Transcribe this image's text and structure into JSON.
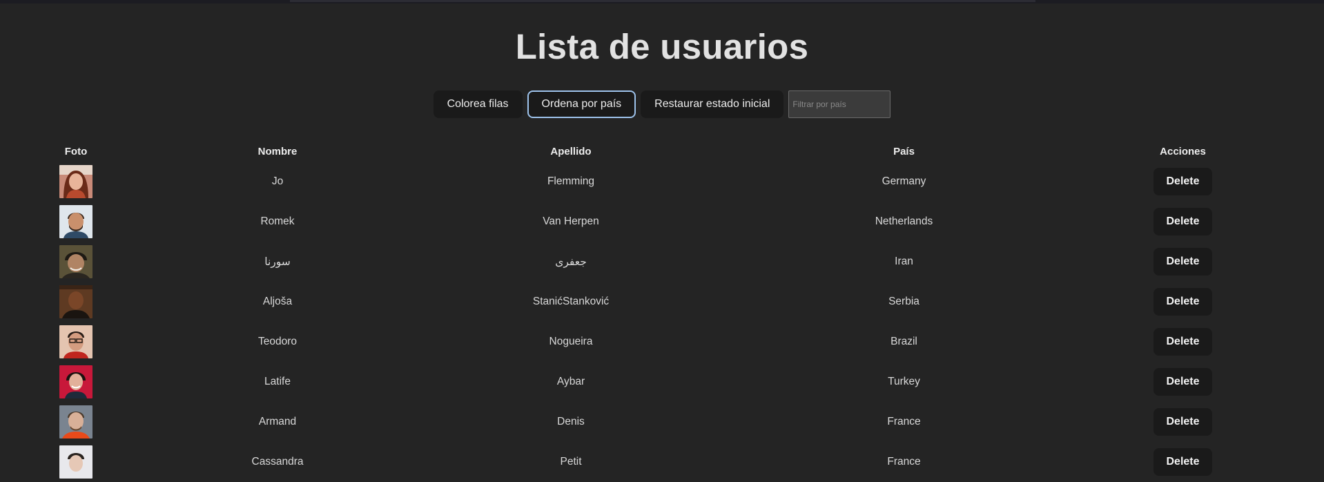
{
  "page": {
    "title": "Lista de usuarios"
  },
  "controls": {
    "color_rows_label": "Colorea filas",
    "sort_country_label": "Ordena por país",
    "reset_label": "Restaurar estado inicial",
    "filter_placeholder": "Filtrar por país"
  },
  "table": {
    "headers": {
      "photo": "Foto",
      "first_name": "Nombre",
      "last_name": "Apellido",
      "country": "País",
      "actions": "Acciones"
    },
    "rows": [
      {
        "first_name": "Jo",
        "last_name": "Flemming",
        "country": "Germany",
        "action": "Delete"
      },
      {
        "first_name": "Romek",
        "last_name": "Van Herpen",
        "country": "Netherlands",
        "action": "Delete"
      },
      {
        "first_name": "سورنا",
        "last_name": "جعفری",
        "country": "Iran",
        "action": "Delete"
      },
      {
        "first_name": "Aljoša",
        "last_name": "StanićStanković",
        "country": "Serbia",
        "action": "Delete"
      },
      {
        "first_name": "Teodoro",
        "last_name": "Nogueira",
        "country": "Brazil",
        "action": "Delete"
      },
      {
        "first_name": "Latife",
        "last_name": "Aybar",
        "country": "Turkey",
        "action": "Delete"
      },
      {
        "first_name": "Armand",
        "last_name": "Denis",
        "country": "France",
        "action": "Delete"
      },
      {
        "first_name": "Cassandra",
        "last_name": "Petit",
        "country": "France",
        "action": "Delete"
      }
    ]
  },
  "colors": {
    "background": "#242424",
    "button_bg": "#1a1a1a",
    "focus_ring": "#9ec3ec"
  }
}
